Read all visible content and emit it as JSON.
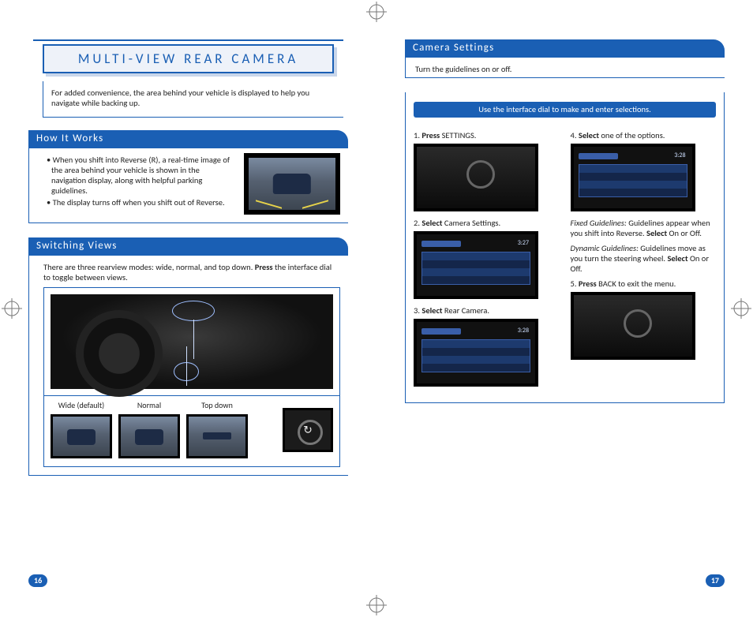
{
  "chapter_title": "MULTI-VIEW REAR CAMERA",
  "intro": "For added convenience, the area behind your vehicle is displayed to help you navigate while backing up.",
  "how_it_works": {
    "title": "How It Works",
    "bullets": [
      "When you shift into Reverse (R), a real-time image of the area behind your vehicle is shown in the navigation display, along with helpful parking guidelines.",
      "The display turns off when you shift out of Reverse."
    ]
  },
  "switching_views": {
    "title": "Switching Views",
    "intro_prefix": "There are three rearview modes: wide, normal, and top down. ",
    "intro_bold": "Press",
    "intro_suffix": " the interface dial to toggle between views.",
    "modes": [
      "Wide (default)",
      "Normal",
      "Top down"
    ]
  },
  "camera_settings": {
    "title": "Camera Settings",
    "subtitle": "Turn the guidelines on or off.",
    "instruction_bar": "Use the interface dial to make and enter selections.",
    "left_steps": [
      {
        "num": "1.",
        "bold": "Press",
        "rest": " SETTINGS."
      },
      {
        "num": "2.",
        "bold": "Select",
        "rest": " Camera Settings."
      },
      {
        "num": "3.",
        "bold": "Select",
        "rest": " Rear Camera."
      }
    ],
    "right_step4": {
      "num": "4.",
      "bold": "Select",
      "rest": " one of the options."
    },
    "fixed_label": "Fixed Guidelines:",
    "fixed_text_a": " Guidelines appear when you shift into Reverse. ",
    "fixed_bold": "Select",
    "fixed_text_b": " On or Off.",
    "dynamic_label": "Dynamic Guidelines:",
    "dynamic_text_a": " Guidelines move as you turn the steering wheel. ",
    "dynamic_bold": "Select",
    "dynamic_text_b": " On or Off.",
    "step5": {
      "num": "5.",
      "bold": "Press",
      "rest": " BACK to exit the menu."
    },
    "clocks": {
      "s2": "3:27",
      "s3": "3:28",
      "s4": "3:28"
    }
  },
  "page_numbers": {
    "left": "16",
    "right": "17"
  }
}
